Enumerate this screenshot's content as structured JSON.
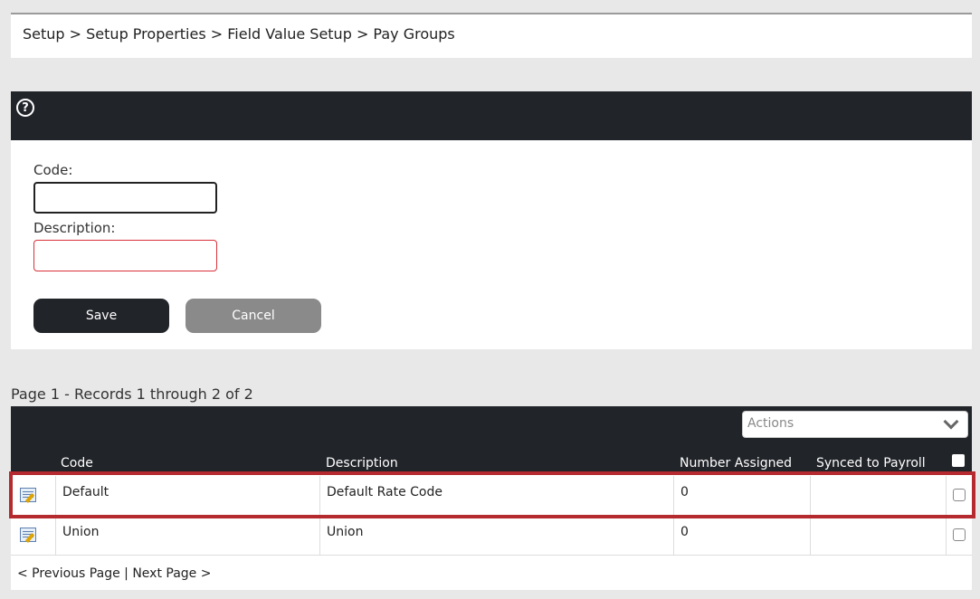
{
  "breadcrumb": {
    "text": "Setup > Setup Properties > Field Value Setup > Pay Groups"
  },
  "form": {
    "help_icon": "question-circle-icon",
    "code_label": "Code:",
    "code_value": "",
    "description_label": "Description:",
    "description_value": "",
    "save_label": "Save",
    "cancel_label": "Cancel"
  },
  "records_info": "Page 1 - Records 1 through 2 of 2",
  "grid": {
    "actions_placeholder": "Actions",
    "columns": [
      "Code",
      "Description",
      "Number Assigned",
      "Synced to Payroll"
    ],
    "rows": [
      {
        "code": "Default",
        "description": "Default Rate Code",
        "number_assigned": "0",
        "synced": ""
      },
      {
        "code": "Union",
        "description": "Union",
        "number_assigned": "0",
        "synced": ""
      }
    ]
  },
  "pager": {
    "prev": "< Previous Page",
    "separator": "|",
    "next": "Next Page >"
  },
  "colors": {
    "header_bg": "#212429",
    "highlight": "#b52a2e",
    "required_border": "#d9303a"
  }
}
